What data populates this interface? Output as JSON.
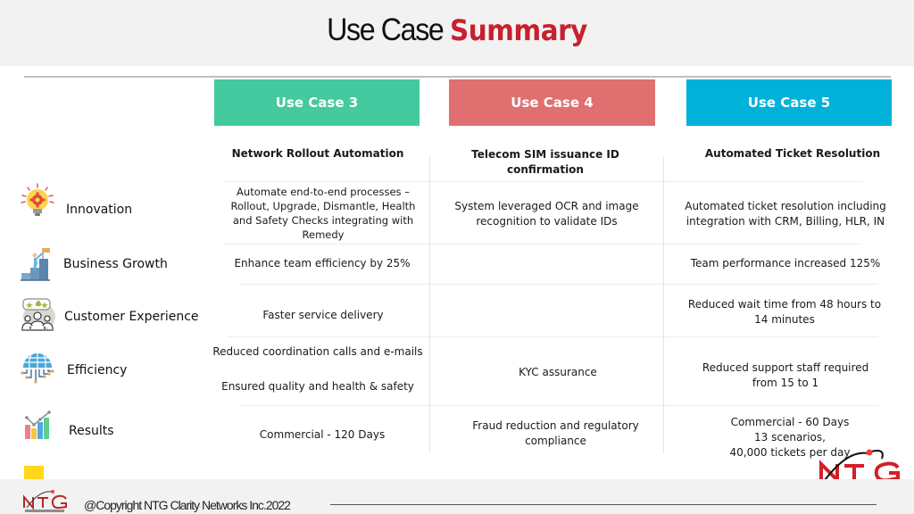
{
  "header": {
    "title_plain": "Use Case",
    "title_accent": "Summary",
    "accent_color": "#c8202e"
  },
  "use_cases": [
    {
      "label": "Use Case 3",
      "color": "#45c99f",
      "title": "Network Rollout Automation"
    },
    {
      "label": "Use Case 4",
      "color": "#e07070",
      "title": "Telecom SIM issuance ID confirmation"
    },
    {
      "label": "Use Case 5",
      "color": "#00b1da",
      "title": "Automated Ticket Resolution"
    }
  ],
  "rows": [
    {
      "label": "Innovation",
      "icon": "lightbulb-gear-icon",
      "cells": [
        "Automate end-to-end processes – Rollout, Upgrade, Dismantle, Health and Safety Checks integrating with Remedy",
        "System leveraged OCR and image recognition to validate IDs",
        "Automated ticket resolution including integration with CRM, Billing, HLR, IN"
      ]
    },
    {
      "label": "Business Growth",
      "icon": "climbing-flag-icon",
      "cells": [
        "Enhance team efficiency by 25%",
        "",
        "Team performance increased 125%"
      ]
    },
    {
      "label": "Customer Experience",
      "icon": "customer-feedback-icon",
      "cells": [
        "Faster service delivery",
        "",
        "Reduced wait time from 48 hours to 14 minutes"
      ]
    },
    {
      "label": "Efficiency",
      "icon": "globe-network-icon",
      "cells": [
        [
          "Reduced coordination calls and e-mails",
          "Ensured quality and health & safety"
        ],
        "KYC assurance",
        "Reduced support staff required from 15 to 1"
      ]
    },
    {
      "label": "Results",
      "icon": "bar-chart-icon",
      "cells": [
        "Commercial - 120 Days",
        "Fraud reduction and regulatory compliance",
        [
          "Commercial - 60 Days",
          "13 scenarios,",
          "40,000 tickets per day"
        ]
      ]
    }
  ],
  "footer": {
    "copyright": "@Copyright NTG Clarity Networks Inc.2022",
    "logo_text": "NTG"
  }
}
